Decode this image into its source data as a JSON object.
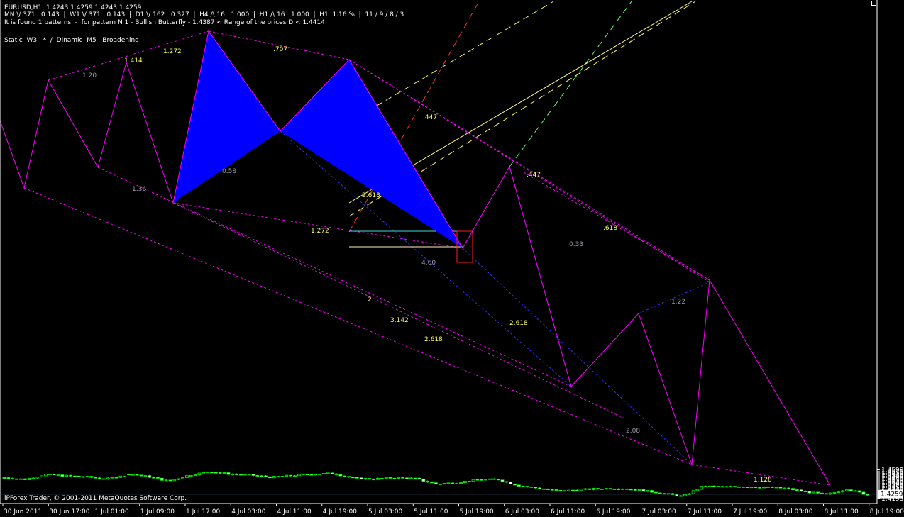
{
  "header": {
    "symbol_line": "EURUSD,H1  1.4243 1.4259 1.4243 1.4259",
    "timeframes_line": "MN \\/ 371   0.143  |  W1 \\/ 371   0.143  |  D1 \\/ 162   0.327  |  H4 /\\ 16   1.000  |  H1 /\\ 16   1.000  |  H1  1.16 %  |  11 / 9 / 8 / 3",
    "pattern_line": "It is found 1 patterns  -  for pattern N 1 - Bullish Butterfly - 1.4387 < Range of the prices D < 1.4414",
    "mode_line": "Static  W3   *  /  Dinamic  M5   Broadening"
  },
  "footer": {
    "copyright": "iPForex Trader, © 2001-2011 MetaQuotes Software Corp."
  },
  "colors": {
    "background": "#000000",
    "axis": "#ffffff",
    "candle_bull": "#000000",
    "candle_outline": "#00ff00",
    "pattern_fill": "#0000ff",
    "zigzag": "#ff00ff",
    "current_price_line": "#6fa8dc",
    "label_yellow": "#ffff66",
    "label_gray": "#9a9aaa"
  },
  "chart_data": {
    "type": "candlestick",
    "ylim": [
      1.419,
      1.4605
    ],
    "y_ticks": [
      "1.4599",
      "1.4575",
      "1.4555",
      "1.4535",
      "1.4515",
      "1.4495",
      "1.4475",
      "1.4455",
      "1.4435",
      "1.4415",
      "1.4395",
      "1.4375",
      "1.4355",
      "1.4335",
      "1.4315",
      "1.4295",
      "1.4275",
      "1.4255",
      "1.4235",
      "1.4215",
      "1.4195"
    ],
    "current_price": "1.4259",
    "x_ticks": [
      "30 Jun 2011",
      "30 Jun 17:00",
      "1 Jul 01:00",
      "1 Jul 09:00",
      "1 Jul 17:00",
      "4 Jul 03:00",
      "4 Jul 11:00",
      "4 Jul 19:00",
      "5 Jul 03:00",
      "5 Jul 11:00",
      "5 Jul 19:00",
      "6 Jul 03:00",
      "6 Jul 11:00",
      "6 Jul 19:00",
      "7 Jul 03:00",
      "7 Jul 11:00",
      "7 Jul 19:00",
      "8 Jul 03:00",
      "8 Jul 11:00",
      "8 Jul 19:00"
    ],
    "approx_price_path": [
      1.449,
      1.4465,
      1.4535,
      1.4515,
      1.45,
      1.447,
      1.4545,
      1.4505,
      1.444,
      1.4525,
      1.4575,
      1.454,
      1.4525,
      1.4495,
      1.452,
      1.454,
      1.455,
      1.448,
      1.447,
      1.449,
      1.4475,
      1.44,
      1.442,
      1.446,
      1.4465,
      1.438,
      1.434,
      1.43,
      1.432,
      1.4335,
      1.434,
      1.431,
      1.427,
      1.4225,
      1.437,
      1.436,
      1.4365,
      1.4355,
      1.434,
      1.429,
      1.425,
      1.433,
      1.4245
    ],
    "pattern_name": "Bullish Butterfly",
    "pattern_range": [
      "1.4387",
      "1.4414"
    ],
    "labels": [
      "1.20",
      "1.414",
      "1.272",
      ".707",
      "1.36",
      "0.58",
      "2.618",
      ".447",
      ".447",
      "1.272",
      "4.60",
      "0.33",
      ".618",
      "2.",
      "3.142",
      "2.618",
      "2.618",
      "1.22",
      "2.08",
      "1.128"
    ]
  }
}
